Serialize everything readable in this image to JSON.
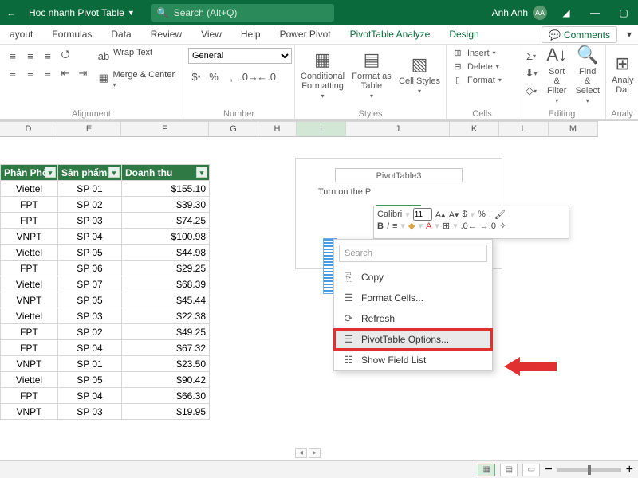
{
  "title": {
    "doc_name": "Hoc nhanh Pivot Table",
    "user_name": "Anh Anh",
    "user_initials": "AA"
  },
  "search": {
    "placeholder": "Search (Alt+Q)"
  },
  "tabs": {
    "layout": "ayout",
    "formulas": "Formulas",
    "data": "Data",
    "review": "Review",
    "view": "View",
    "help": "Help",
    "powerpivot": "Power Pivot",
    "pt_analyze": "PivotTable Analyze",
    "design": "Design",
    "comments": "Comments"
  },
  "ribbon": {
    "alignment": {
      "label": "Alignment",
      "wrap": "Wrap Text",
      "merge": "Merge & Center"
    },
    "number": {
      "label": "Number",
      "format": "General"
    },
    "styles": {
      "label": "Styles",
      "cond": "Conditional Formatting",
      "table": "Format as Table",
      "cell": "Cell Styles"
    },
    "cells": {
      "label": "Cells",
      "insert": "Insert",
      "delete": "Delete",
      "format": "Format"
    },
    "editing": {
      "label": "Editing",
      "sort": "Sort & Filter",
      "find": "Find & Select"
    },
    "analysis": {
      "label": "Analy",
      "btn": "Analy Dat"
    }
  },
  "columns": {
    "d": "D",
    "e": "E",
    "f": "F",
    "g": "G",
    "h": "H",
    "i": "I",
    "j": "J",
    "k": "K",
    "l": "L",
    "m": "M"
  },
  "table": {
    "headers": {
      "dist": "Phân Phố",
      "product": "Sản phẩm",
      "revenue": "Doanh thu"
    },
    "rows": [
      {
        "dist": "Viettel",
        "product": "SP 01",
        "rev": "$155.10"
      },
      {
        "dist": "FPT",
        "product": "SP 02",
        "rev": "$39.30"
      },
      {
        "dist": "FPT",
        "product": "SP 03",
        "rev": "$74.25"
      },
      {
        "dist": "VNPT",
        "product": "SP 04",
        "rev": "$100.98"
      },
      {
        "dist": "Viettel",
        "product": "SP 05",
        "rev": "$44.98"
      },
      {
        "dist": "FPT",
        "product": "SP 06",
        "rev": "$29.25"
      },
      {
        "dist": "Viettel",
        "product": "SP 07",
        "rev": "$68.39"
      },
      {
        "dist": "VNPT",
        "product": "SP 05",
        "rev": "$45.44"
      },
      {
        "dist": "Viettel",
        "product": "SP 03",
        "rev": "$22.38"
      },
      {
        "dist": "FPT",
        "product": "SP 02",
        "rev": "$49.25"
      },
      {
        "dist": "FPT",
        "product": "SP 04",
        "rev": "$67.32"
      },
      {
        "dist": "VNPT",
        "product": "SP 01",
        "rev": "$23.50"
      },
      {
        "dist": "Viettel",
        "product": "SP 05",
        "rev": "$90.42"
      },
      {
        "dist": "FPT",
        "product": "SP 04",
        "rev": "$66.30"
      },
      {
        "dist": "VNPT",
        "product": "SP 03",
        "rev": "$19.95"
      }
    ]
  },
  "pivot": {
    "name": "PivotTable3",
    "hint": "Turn on the P"
  },
  "minibar": {
    "font": "Calibri",
    "size": "11"
  },
  "context": {
    "search": "Search",
    "copy": "Copy",
    "format_cells": "Format Cells...",
    "refresh": "Refresh",
    "options": "PivotTable Options...",
    "field_list": "Show Field List"
  }
}
